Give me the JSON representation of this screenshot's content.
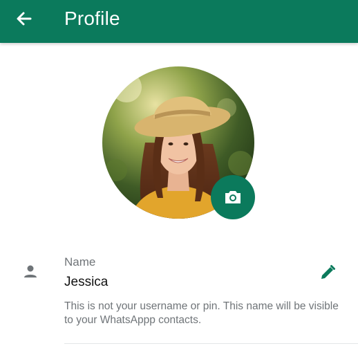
{
  "header": {
    "title": "Profile",
    "back_icon": "arrow-left-icon",
    "background_color": "#0b7a5c"
  },
  "profile": {
    "avatar": "profile-photo-woman-straw-hat",
    "camera_icon": "camera-icon"
  },
  "name_field": {
    "icon": "person-icon",
    "label": "Name",
    "value": "Jessica",
    "edit_icon": "pencil-icon",
    "hint": "This is not your username or pin. This name will be visible to your WhatsAppp contacts."
  },
  "colors": {
    "accent": "#0b7a5c",
    "secondary_text": "#6f7478",
    "primary_text": "#111111"
  }
}
